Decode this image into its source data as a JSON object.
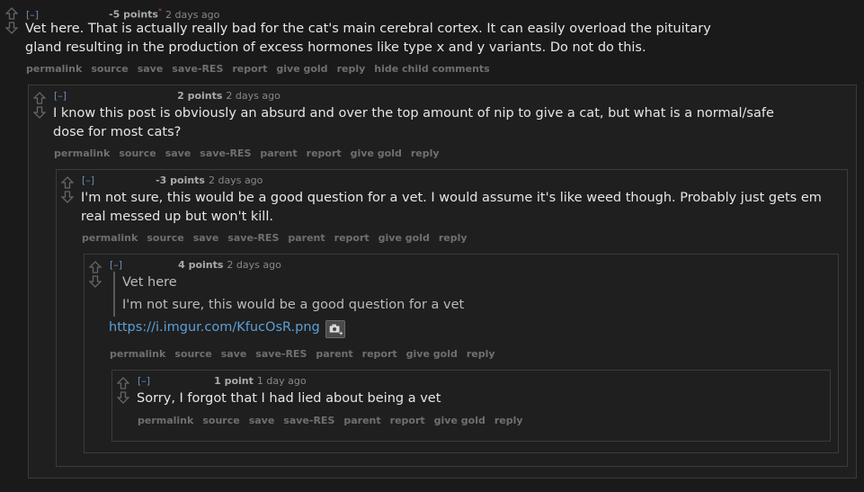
{
  "comments": [
    {
      "expand": "[–]",
      "score": "-5 points",
      "flair": "*",
      "time": "2 days ago",
      "body": "Vet here. That is actually really bad for the cat's main cerebral cortex. It can easily overload the pituitary gland resulting in the production of excess hormones like type x and y variants. Do not do this.",
      "buttons": [
        "permalink",
        "source",
        "save",
        "save-RES",
        "report",
        "give gold",
        "reply",
        "hide child comments"
      ]
    },
    {
      "expand": "[–]",
      "score": "2 points",
      "time": "2 days ago",
      "body": "I know this post is obviously an absurd and over the top amount of nip to give a cat, but what is a normal/safe dose for most cats?",
      "buttons": [
        "permalink",
        "source",
        "save",
        "save-RES",
        "parent",
        "report",
        "give gold",
        "reply"
      ]
    },
    {
      "expand": "[–]",
      "score": "-3 points",
      "time": "2 days ago",
      "body": "I'm not sure, this would be a good question for a vet. I would assume it's like weed though. Probably just gets em real messed up but won't kill.",
      "buttons": [
        "permalink",
        "source",
        "save",
        "save-RES",
        "parent",
        "report",
        "give gold",
        "reply"
      ]
    },
    {
      "expand": "[–]",
      "score": "4 points",
      "time": "2 days ago",
      "quote": [
        "Vet here",
        "I'm not sure, this would be a good question for a vet"
      ],
      "link": "https://i.imgur.com/KfucOsR.png",
      "buttons": [
        "permalink",
        "source",
        "save",
        "save-RES",
        "parent",
        "report",
        "give gold",
        "reply"
      ]
    },
    {
      "expand": "[–]",
      "score": "1 point",
      "time": "1 day ago",
      "body": "Sorry, I forgot that I had lied about being a vet",
      "buttons": [
        "permalink",
        "source",
        "save",
        "save-RES",
        "parent",
        "report",
        "give gold",
        "reply"
      ]
    }
  ],
  "icons": {
    "upvote": "upvote-arrow-icon",
    "downvote": "downvote-arrow-icon",
    "image_expand": "camera-expand-icon"
  }
}
